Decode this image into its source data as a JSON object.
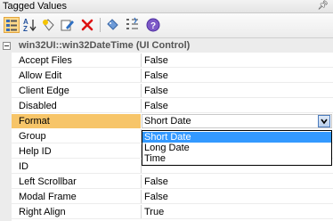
{
  "panel": {
    "title": "Tagged Values",
    "pin_icon": "pin-icon"
  },
  "toolbar": {
    "buttons": [
      {
        "icon": "categorized-view-icon",
        "active": true
      },
      {
        "icon": "sort-alphabetical-icon"
      },
      {
        "icon": "new-tag-icon"
      },
      {
        "icon": "edit-tag-icon"
      },
      {
        "icon": "delete-tag-icon"
      },
      {
        "icon": "tag-group-icon"
      },
      {
        "icon": "show-inherited-icon"
      },
      {
        "icon": "help-icon"
      }
    ],
    "active_color": "#ffd98a"
  },
  "grid": {
    "group": {
      "label": "win32UI::win32DateTime (UI Control)"
    },
    "rows": [
      {
        "name": "Accept Files",
        "value": "False"
      },
      {
        "name": "Allow Edit",
        "value": "False"
      },
      {
        "name": "Client Edge",
        "value": "False"
      },
      {
        "name": "Disabled",
        "value": "False"
      },
      {
        "name": "Format",
        "value": "Short Date",
        "selected": true
      },
      {
        "name": "Group",
        "value": ""
      },
      {
        "name": "Help ID",
        "value": ""
      },
      {
        "name": "ID",
        "value": ""
      },
      {
        "name": "Left Scrollbar",
        "value": "False"
      },
      {
        "name": "Modal Frame",
        "value": "False"
      },
      {
        "name": "Right Align",
        "value": "True"
      }
    ],
    "selection_color": "#f7c569"
  },
  "dropdown": {
    "options": [
      "Short Date",
      "Long Date",
      "Time"
    ],
    "highlighted": "Short Date",
    "highlight_color": "#3399ff"
  }
}
